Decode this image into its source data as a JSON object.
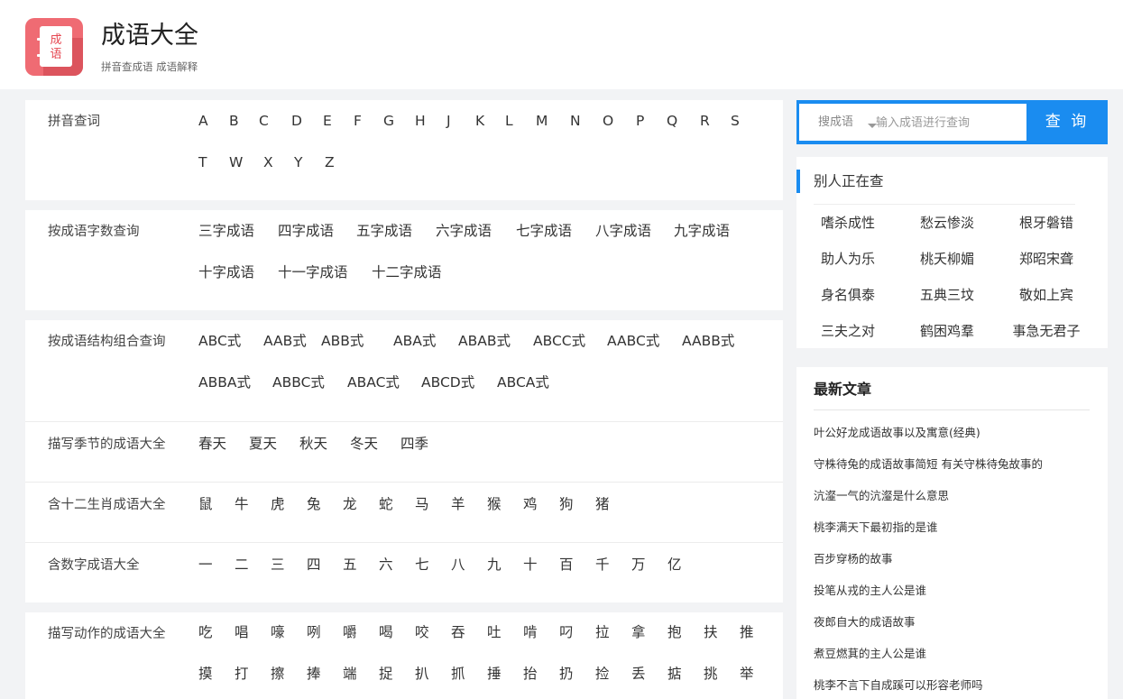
{
  "header": {
    "logo_chars": [
      "成",
      "语"
    ],
    "title": "成语大全",
    "subtitle": "拼音查成语 成语解释"
  },
  "panels": {
    "pinyin": {
      "label": "拼音查词",
      "rows": [
        [
          "A",
          "B",
          "C",
          "D",
          "E",
          "F",
          "G",
          "H",
          "J",
          "K",
          "L",
          "M",
          "N",
          "O",
          "P",
          "Q",
          "R",
          "S"
        ],
        [
          "T",
          "W",
          "X",
          "Y",
          "Z"
        ]
      ]
    },
    "count": {
      "label": "按成语字数查询",
      "rows": [
        [
          "三字成语",
          "四字成语",
          "五字成语",
          "六字成语",
          "七字成语",
          "八字成语",
          "九字成语"
        ],
        [
          "十字成语",
          "十一字成语",
          "十二字成语"
        ]
      ]
    },
    "structure": {
      "label": "按成语结构组合查询",
      "rows": [
        [
          "ABC式",
          "AAB式",
          "ABB式",
          "ABA式",
          "ABAB式",
          "ABCC式",
          "AABC式",
          "AABB式"
        ],
        [
          "ABBA式",
          "ABBC式",
          "ABAC式",
          "ABCD式",
          "ABCA式"
        ]
      ]
    },
    "season": {
      "label": "描写季节的成语大全",
      "rows": [
        [
          "春天",
          "夏天",
          "秋天",
          "冬天",
          "四季"
        ]
      ]
    },
    "zodiac": {
      "label": "含十二生肖成语大全",
      "rows": [
        [
          "鼠",
          "牛",
          "虎",
          "兔",
          "龙",
          "蛇",
          "马",
          "羊",
          "猴",
          "鸡",
          "狗",
          "猪"
        ]
      ]
    },
    "number": {
      "label": "含数字成语大全",
      "rows": [
        [
          "一",
          "二",
          "三",
          "四",
          "五",
          "六",
          "七",
          "八",
          "九",
          "十",
          "百",
          "千",
          "万",
          "亿"
        ]
      ]
    },
    "action": {
      "label": "描写动作的成语大全",
      "rows": [
        [
          "吃",
          "唱",
          "嚎",
          "咧",
          "嚼",
          "喝",
          "咬",
          "吞",
          "吐",
          "啃",
          "叼",
          "拉",
          "拿",
          "抱",
          "扶",
          "推"
        ],
        [
          "摸",
          "打",
          "擦",
          "捧",
          "端",
          "捉",
          "扒",
          "抓",
          "捶",
          "抬",
          "扔",
          "捡",
          "丢",
          "掂",
          "挑",
          "举"
        ]
      ]
    }
  },
  "search": {
    "type_label": "搜成语",
    "placeholder": "输入成语进行查询",
    "button_label": "查 询",
    "accent": "#1a8cf0"
  },
  "hot": {
    "title": "别人正在查",
    "items": [
      "嗜杀成性",
      "愁云惨淡",
      "根牙磐错",
      "助人为乐",
      "桃夭柳媚",
      "郑昭宋聋",
      "身名俱泰",
      "五典三坟",
      "敬如上宾",
      "三夫之对",
      "鹤困鸡羣",
      "事急无君子"
    ]
  },
  "news": {
    "title": "最新文章",
    "items": [
      "叶公好龙成语故事以及寓意(经典)",
      "守株待兔的成语故事简短 有关守株待兔故事的",
      "沆瀣一气的沆瀣是什么意思",
      "桃李满天下最初指的是谁",
      "百步穿杨的故事",
      "投笔从戎的主人公是谁",
      "夜郎自大的成语故事",
      "煮豆燃萁的主人公是谁",
      "桃李不言下自成蹊可以形容老师吗"
    ]
  }
}
